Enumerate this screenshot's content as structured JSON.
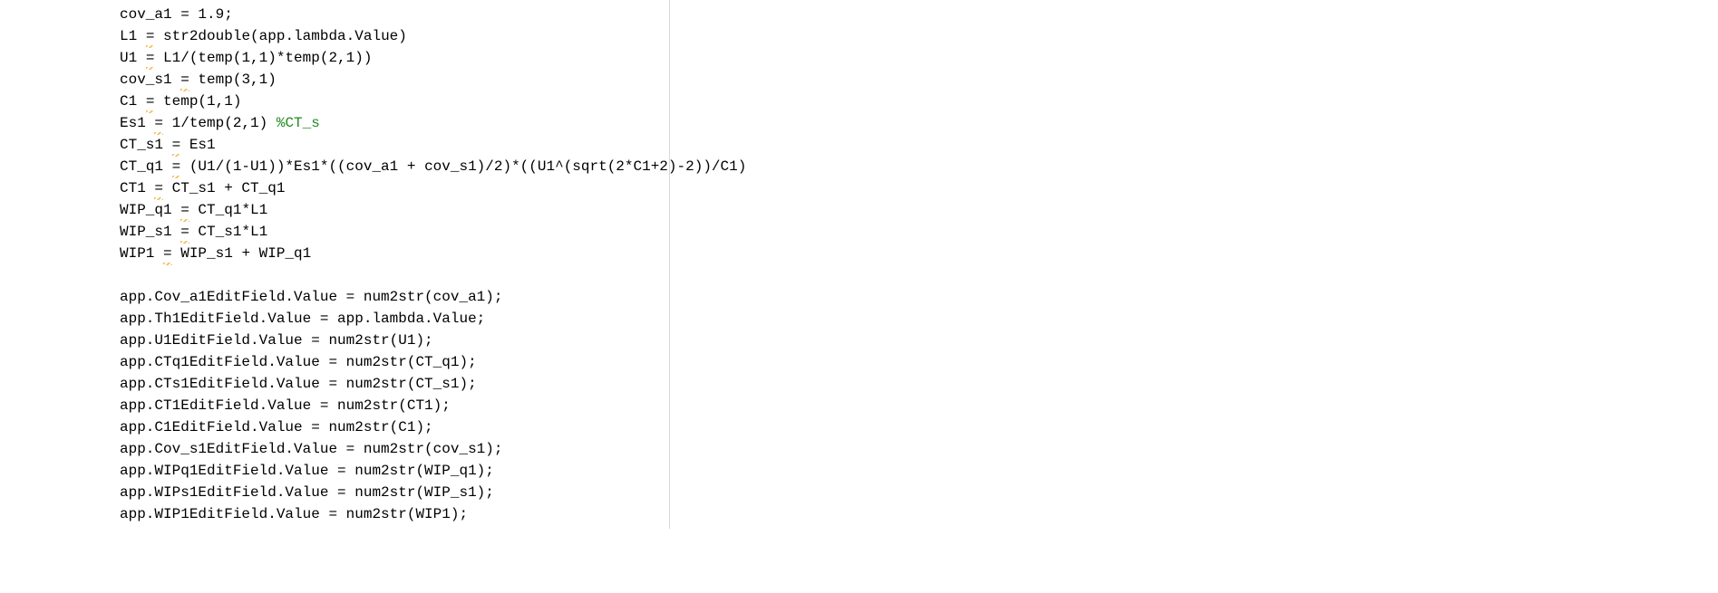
{
  "code": {
    "lines": [
      {
        "warn_eq": false,
        "pre": "cov_a1 = 1.9;",
        "post": "",
        "comment": ""
      },
      {
        "warn_eq": true,
        "pre": "L1 ",
        "post": " str2double(app.lambda.Value)",
        "comment": ""
      },
      {
        "warn_eq": true,
        "pre": "U1 ",
        "post": " L1/(temp(1,1)*temp(2,1))",
        "comment": ""
      },
      {
        "warn_eq": true,
        "pre": "cov_s1 ",
        "post": " temp(3,1)",
        "comment": ""
      },
      {
        "warn_eq": true,
        "pre": "C1 ",
        "post": " temp(1,1)",
        "comment": ""
      },
      {
        "warn_eq": true,
        "pre": "Es1 ",
        "post": " 1/temp(2,1) ",
        "comment": "%CT_s"
      },
      {
        "warn_eq": true,
        "pre": "CT_s1 ",
        "post": " Es1",
        "comment": ""
      },
      {
        "warn_eq": true,
        "pre": "CT_q1 ",
        "post": " (U1/(1-U1))*Es1*((cov_a1 + cov_s1)/2)*((U1^(sqrt(2*C1+2)-2))/C1)",
        "comment": ""
      },
      {
        "warn_eq": true,
        "pre": "CT1 ",
        "post": " CT_s1 + CT_q1",
        "comment": ""
      },
      {
        "warn_eq": true,
        "pre": "WIP_q1 ",
        "post": " CT_q1*L1",
        "comment": ""
      },
      {
        "warn_eq": true,
        "pre": "WIP_s1 ",
        "post": " CT_s1*L1",
        "comment": ""
      },
      {
        "warn_eq": true,
        "pre": "WIP1 ",
        "post": " WIP_s1 + WIP_q1",
        "comment": ""
      },
      {
        "warn_eq": false,
        "pre": "",
        "post": "",
        "comment": ""
      },
      {
        "warn_eq": false,
        "pre": "app.Cov_a1EditField.Value = num2str(cov_a1);",
        "post": "",
        "comment": ""
      },
      {
        "warn_eq": false,
        "pre": "app.Th1EditField.Value = app.lambda.Value;",
        "post": "",
        "comment": ""
      },
      {
        "warn_eq": false,
        "pre": "app.U1EditField.Value = num2str(U1);",
        "post": "",
        "comment": ""
      },
      {
        "warn_eq": false,
        "pre": "app.CTq1EditField.Value = num2str(CT_q1);",
        "post": "",
        "comment": ""
      },
      {
        "warn_eq": false,
        "pre": "app.CTs1EditField.Value = num2str(CT_s1);",
        "post": "",
        "comment": ""
      },
      {
        "warn_eq": false,
        "pre": "app.CT1EditField.Value = num2str(CT1);",
        "post": "",
        "comment": ""
      },
      {
        "warn_eq": false,
        "pre": "app.C1EditField.Value = num2str(C1);",
        "post": "",
        "comment": ""
      },
      {
        "warn_eq": false,
        "pre": "app.Cov_s1EditField.Value = num2str(cov_s1);",
        "post": "",
        "comment": ""
      },
      {
        "warn_eq": false,
        "pre": "app.WIPq1EditField.Value = num2str(WIP_q1);",
        "post": "",
        "comment": ""
      },
      {
        "warn_eq": false,
        "pre": "app.WIPs1EditField.Value = num2str(WIP_s1);",
        "post": "",
        "comment": ""
      },
      {
        "warn_eq": false,
        "pre": "app.WIP1EditField.Value = num2str(WIP1);",
        "post": "",
        "comment": ""
      }
    ]
  }
}
